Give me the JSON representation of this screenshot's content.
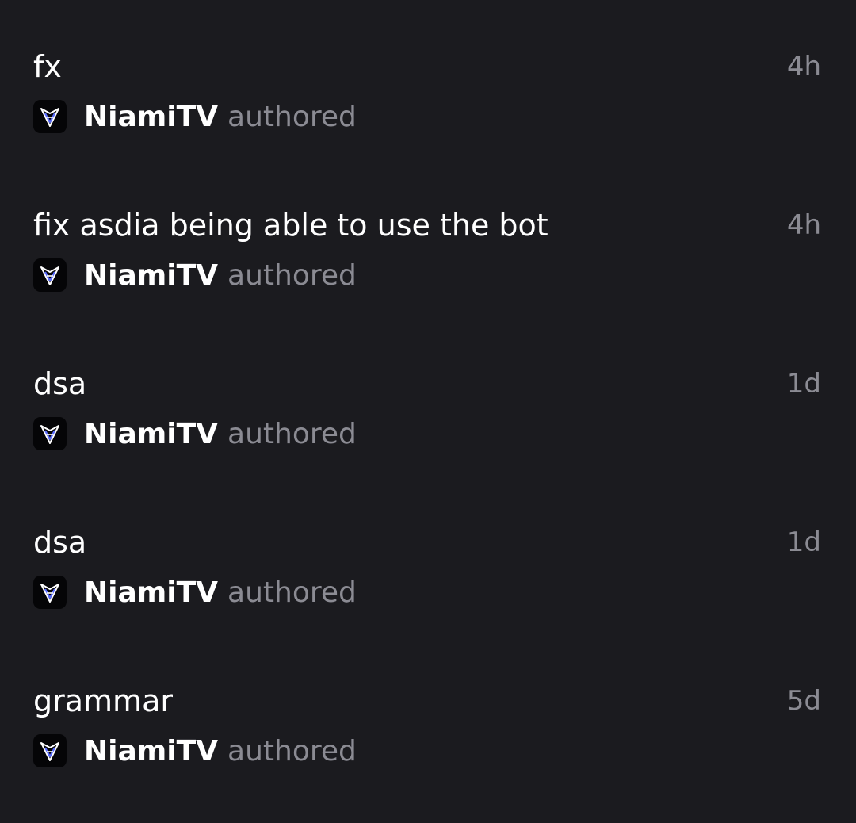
{
  "commits": [
    {
      "message": "fx",
      "time": "4h",
      "author": "NiamiTV",
      "action": "authored",
      "avatar_icon": "niamitv-logo-icon"
    },
    {
      "message": "fix asdia being able to use the bot",
      "time": "4h",
      "author": "NiamiTV",
      "action": "authored",
      "avatar_icon": "niamitv-logo-icon"
    },
    {
      "message": "dsa",
      "time": "1d",
      "author": "NiamiTV",
      "action": "authored",
      "avatar_icon": "niamitv-logo-icon"
    },
    {
      "message": "dsa",
      "time": "1d",
      "author": "NiamiTV",
      "action": "authored",
      "avatar_icon": "niamitv-logo-icon"
    },
    {
      "message": "grammar",
      "time": "5d",
      "author": "NiamiTV",
      "action": "authored",
      "avatar_icon": "niamitv-logo-icon"
    }
  ],
  "colors": {
    "background": "#1b1b1f",
    "primary_text": "#ffffff",
    "secondary_text": "#8b8b93",
    "avatar_background": "#050507",
    "avatar_accent": "#5a6cff"
  }
}
